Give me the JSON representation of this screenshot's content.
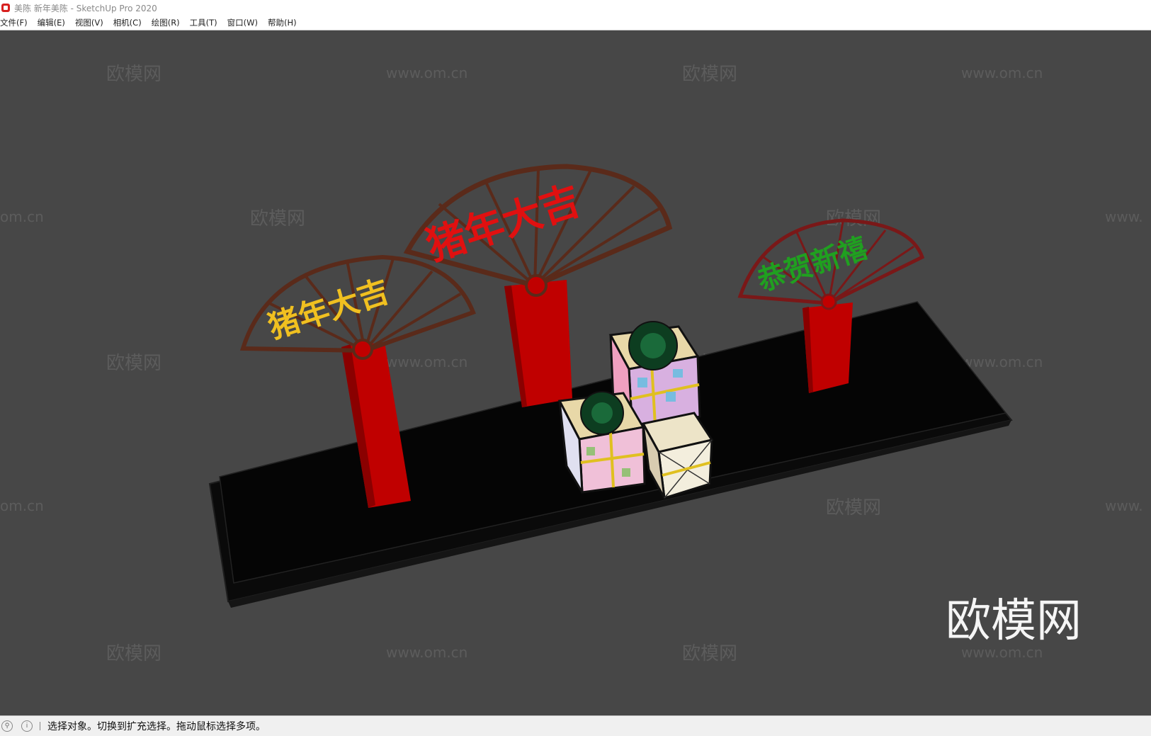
{
  "window": {
    "title": "美陈 新年美陈 - SketchUp Pro 2020"
  },
  "menubar": {
    "items": [
      {
        "label": "文件(F)"
      },
      {
        "label": "编辑(E)"
      },
      {
        "label": "视图(V)"
      },
      {
        "label": "相机(C)"
      },
      {
        "label": "绘图(R)"
      },
      {
        "label": "工具(T)"
      },
      {
        "label": "窗口(W)"
      },
      {
        "label": "帮助(H)"
      }
    ]
  },
  "viewport": {
    "background": "#474747",
    "model": {
      "fan_left_text": "猪年大吉",
      "fan_center_text": "猪年大吉",
      "fan_right_text": "恭贺新禧"
    },
    "watermarks": {
      "brand": "欧模网",
      "url": "www.om.cn",
      "url_partial": "om.cn",
      "url_partial_right": "www."
    }
  },
  "statusbar": {
    "icons": [
      "geo-location-icon",
      "info-icon"
    ],
    "message": "选择对象。切换到扩充选择。拖动鼠标选择多项。"
  },
  "colors": {
    "fan_frame": "#5a2a1a",
    "red": "#c00000",
    "yellow_text": "#f0c020",
    "green_text": "#20a020",
    "base": "#0a0a0a"
  }
}
